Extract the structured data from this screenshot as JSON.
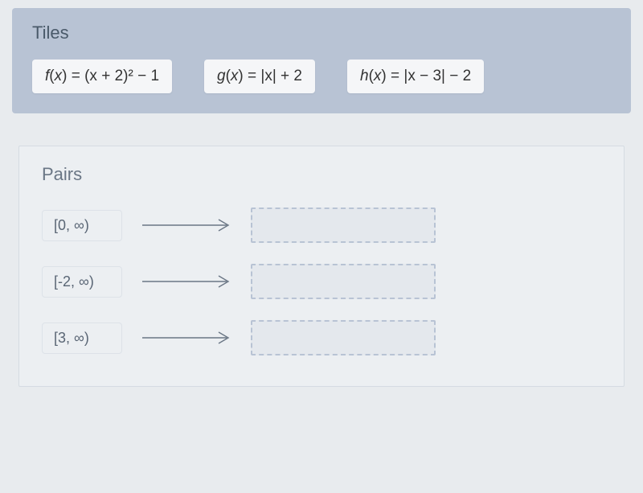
{
  "tiles": {
    "heading": "Tiles",
    "items": [
      {
        "fn": "f",
        "expr": "(x + 2)² − 1"
      },
      {
        "fn": "g",
        "expr": "|x| + 2"
      },
      {
        "fn": "h",
        "expr": "|x − 3| − 2"
      }
    ]
  },
  "pairs": {
    "heading": "Pairs",
    "rows": [
      {
        "label": "[0, ∞)"
      },
      {
        "label": "[-2, ∞)"
      },
      {
        "label": "[3, ∞)"
      }
    ]
  }
}
